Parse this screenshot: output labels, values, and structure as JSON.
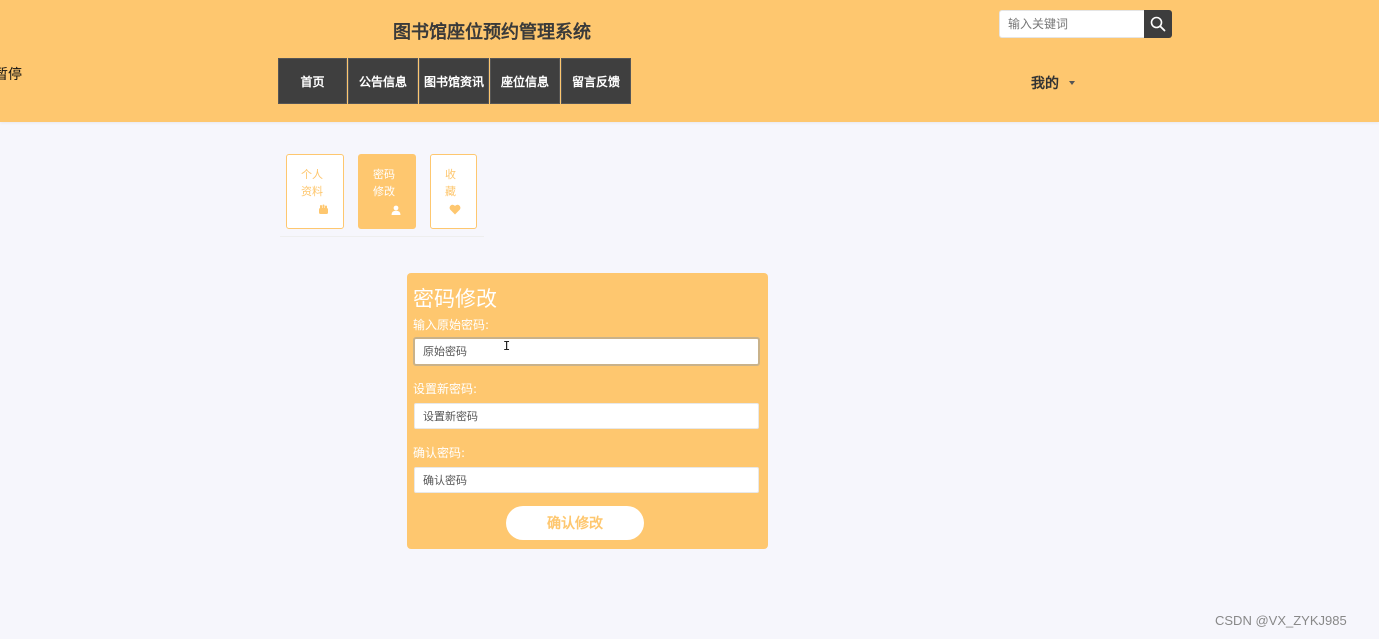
{
  "header": {
    "site_title": "图书馆座位预约管理系统",
    "marquee_text": "暂停",
    "search": {
      "placeholder": "输入关键词",
      "button_icon": "search-icon"
    },
    "nav": [
      {
        "label": "首页"
      },
      {
        "label": "公告信息"
      },
      {
        "label": "图书馆资讯"
      },
      {
        "label": "座位信息"
      },
      {
        "label": "留言反馈"
      }
    ],
    "user_menu": {
      "label": "我的",
      "icon": "caret-down-icon"
    }
  },
  "sidebar_tabs": [
    {
      "label": "个人资料",
      "icon": "hand-icon",
      "active": false
    },
    {
      "label": "密码修改",
      "icon": "user-icon",
      "active": true
    },
    {
      "label": "收藏",
      "icon": "heart-icon",
      "active": false
    }
  ],
  "form": {
    "title": "密码修改",
    "fields": [
      {
        "label": "输入原始密码:",
        "placeholder": "原始密码",
        "value": ""
      },
      {
        "label": "设置新密码:",
        "placeholder": "设置新密码",
        "value": ""
      },
      {
        "label": "确认密码:",
        "placeholder": "确认密码",
        "value": ""
      }
    ],
    "submit_label": "确认修改"
  },
  "watermark": "CSDN @VX_ZYKJ985",
  "colors": {
    "header_bg": "#fec76f",
    "nav_bg": "#3f3f3f",
    "page_bg": "#f6f6fc",
    "accent": "#fec76f"
  }
}
